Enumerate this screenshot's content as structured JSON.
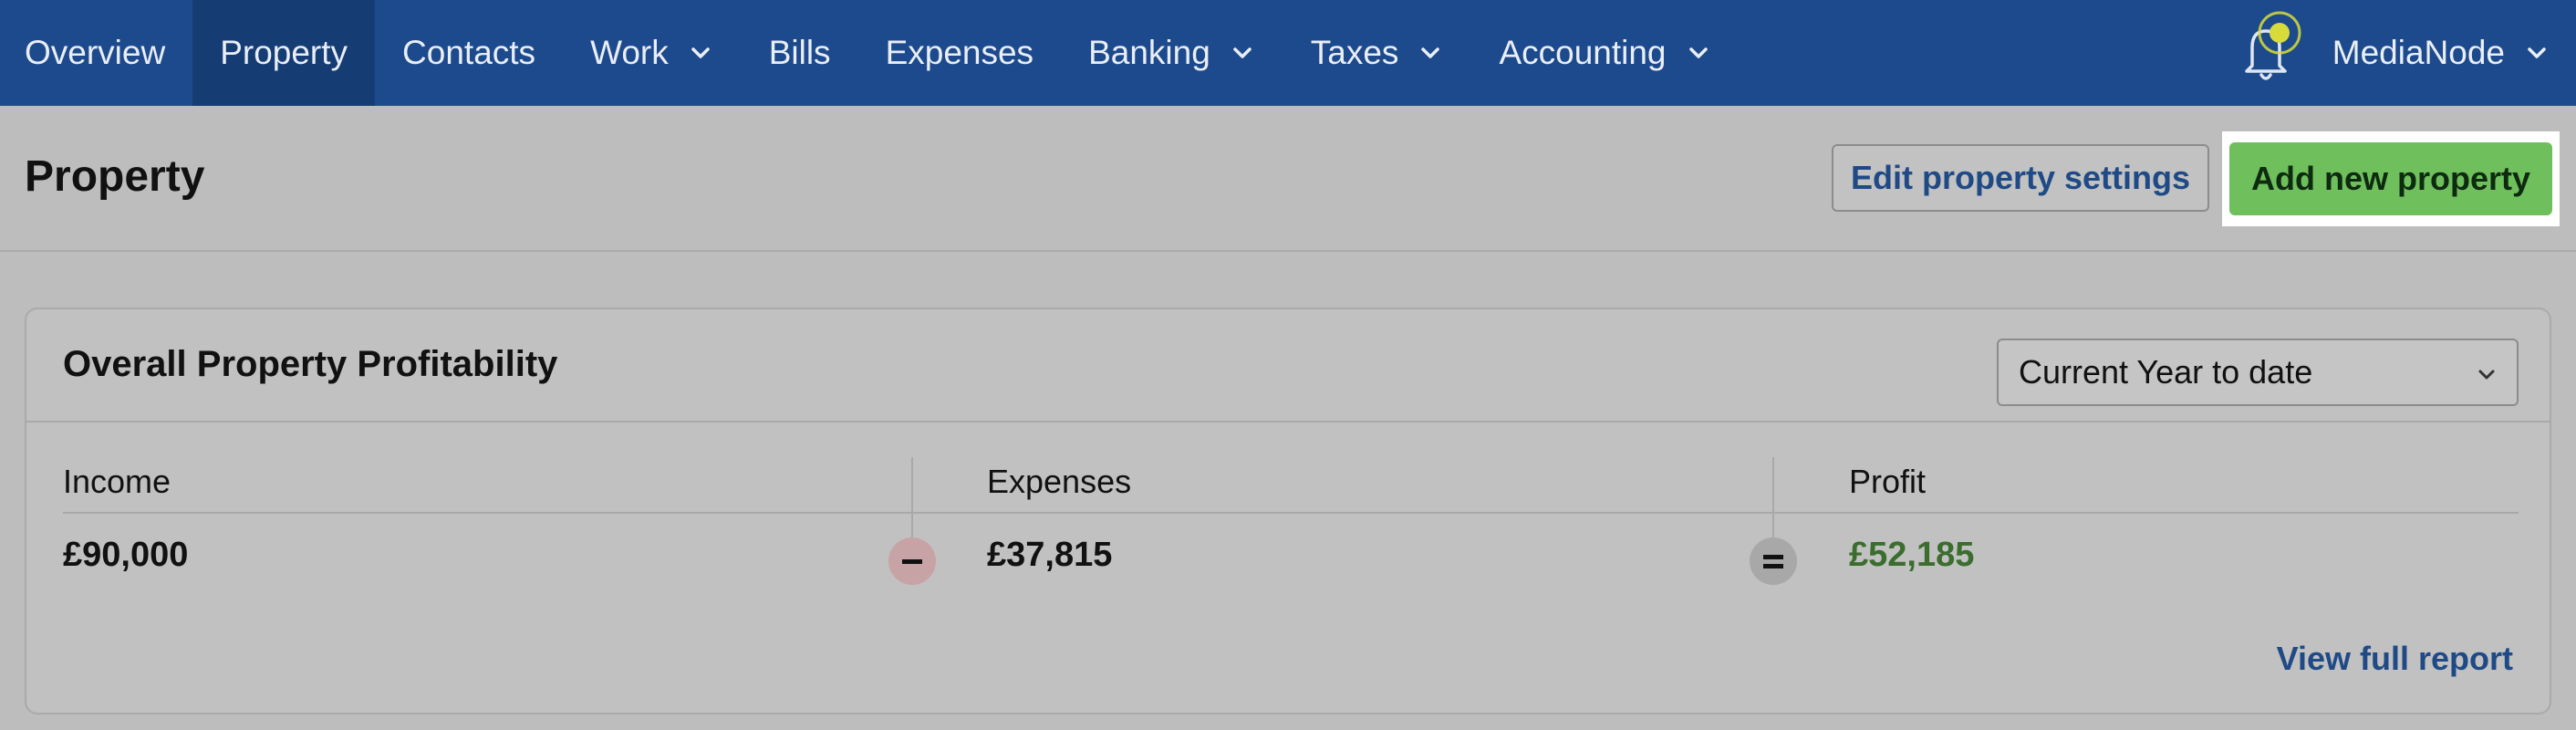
{
  "nav": {
    "items": [
      {
        "label": "Overview",
        "dropdown": false,
        "active": false
      },
      {
        "label": "Property",
        "dropdown": false,
        "active": true
      },
      {
        "label": "Contacts",
        "dropdown": false,
        "active": false
      },
      {
        "label": "Work",
        "dropdown": true,
        "active": false
      },
      {
        "label": "Bills",
        "dropdown": false,
        "active": false
      },
      {
        "label": "Expenses",
        "dropdown": false,
        "active": false
      },
      {
        "label": "Banking",
        "dropdown": true,
        "active": false
      },
      {
        "label": "Taxes",
        "dropdown": true,
        "active": false
      },
      {
        "label": "Accounting",
        "dropdown": true,
        "active": false
      }
    ],
    "account_name": "MediaNode",
    "icons": {
      "notifications": "bell-icon",
      "dropdown": "chevron-down-icon"
    }
  },
  "header": {
    "title": "Property",
    "edit_button": "Edit property settings",
    "add_button": "Add new property"
  },
  "card": {
    "title": "Overall Property Profitability",
    "period_select": "Current Year to date",
    "columns": {
      "income": {
        "label": "Income",
        "value": "£90,000"
      },
      "expenses": {
        "label": "Expenses",
        "value": "£37,815"
      },
      "profit": {
        "label": "Profit",
        "value": "£52,185"
      }
    },
    "operators": {
      "minus": "minus-icon",
      "equals": "equals-icon"
    },
    "report_link": "View full report"
  },
  "colors": {
    "nav_bg": "#1d4a8c",
    "nav_active": "#163c74",
    "accent_green": "#6fc05d",
    "profit_green": "#3a6d2e",
    "link_blue": "#1f4a86",
    "notification_dot": "#d8dc3a"
  }
}
